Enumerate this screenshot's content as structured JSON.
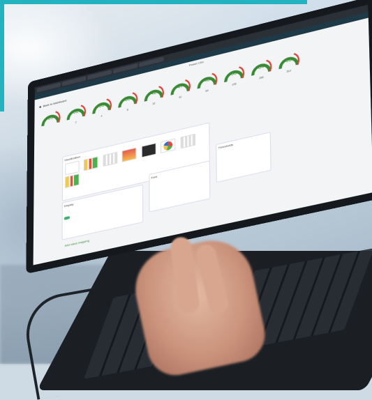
{
  "scene": {
    "accent_cyan": "#22b2c0",
    "gauge_green": "#3a8a35",
    "gauge_red": "#d9443a"
  },
  "screen": {
    "page_title": "Power Ctrs",
    "app_name": "IBY BSSCI",
    "back_link": "Back to dashboard",
    "gauges": [
      {
        "value": "55",
        "sub": ""
      },
      {
        "value": "52",
        "sub": "2"
      },
      {
        "value": "50",
        "sub": "4"
      },
      {
        "value": "38",
        "sub": "8"
      },
      {
        "value": "42",
        "sub": "16"
      },
      {
        "value": "47",
        "sub": "32"
      },
      {
        "value": "48",
        "sub": "64"
      },
      {
        "value": "50",
        "sub": "128"
      },
      {
        "value": "54",
        "sub": "256"
      },
      {
        "value": "56",
        "sub": "512"
      }
    ],
    "visualization_label": "Visualization",
    "display_label": "Display",
    "font_label": "Font",
    "thresholds_label": "Thresholds",
    "add_value_mapping": "Add value mapping"
  }
}
